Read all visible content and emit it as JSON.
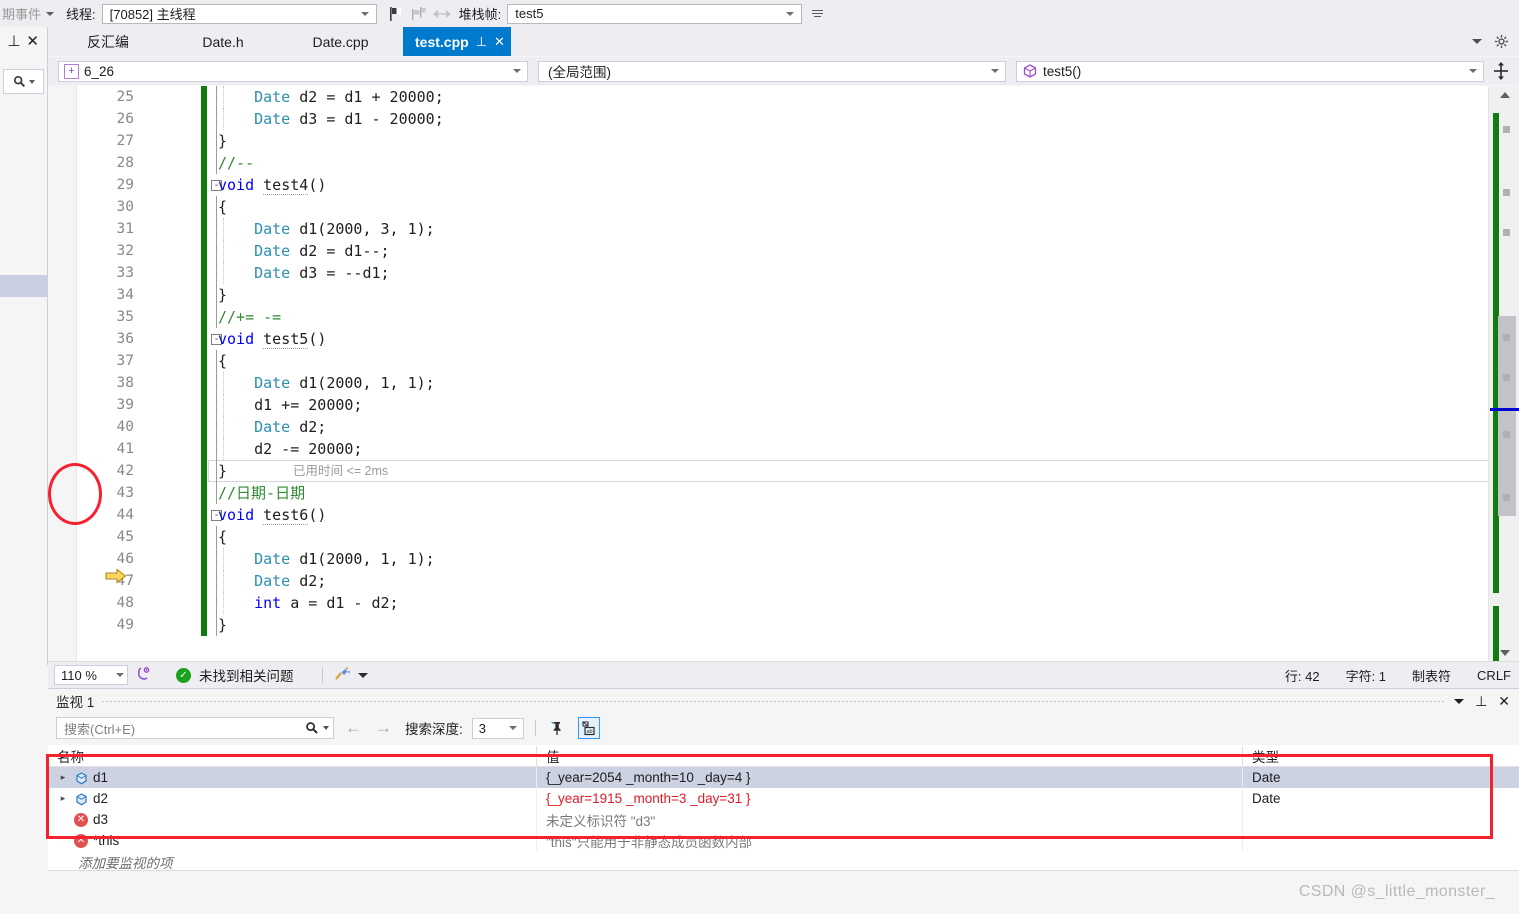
{
  "toolbar": {
    "events_label": "期事件",
    "thread_label": "线程:",
    "thread_value": "[70852] 主线程",
    "stackframe_label": "堆栈帧:",
    "stackframe_value": "test5",
    "icons": [
      "flag-icon",
      "flags-faded-icon",
      "link-faded-icon",
      "overflow-icon"
    ]
  },
  "left_strip": {
    "pin_icon": "pin-icon",
    "close_icon": "close-icon",
    "search_icon": "search-icon",
    "search_caret": "chevron-down-icon"
  },
  "tabs": {
    "items": [
      {
        "label": "反汇编",
        "active": false
      },
      {
        "label": "Date.h",
        "active": false
      },
      {
        "label": "Date.cpp",
        "active": false
      },
      {
        "label": "test.cpp",
        "active": true
      }
    ],
    "pin_icon": "pin-icon",
    "close_icon": "close-icon",
    "overflow_icon": "chevron-down-icon",
    "settings_icon": "gear-icon"
  },
  "navbar": {
    "project": "6_26",
    "project_icon": "project-icon",
    "scope": "(全局范围)",
    "member": "test5()",
    "member_icon": "cube-icon",
    "split_icon": "split-window-icon"
  },
  "editor": {
    "first_line": 25,
    "lines": [
      {
        "n": 25,
        "tokens": [
          {
            "t": "typ",
            "s": "Date"
          },
          {
            "t": "pln",
            "s": " d2 = d1 + "
          },
          {
            "t": "num",
            "s": "20000"
          },
          {
            "t": "pln",
            "s": ";"
          }
        ],
        "indent": 3,
        "change": true
      },
      {
        "n": 26,
        "tokens": [
          {
            "t": "typ",
            "s": "Date"
          },
          {
            "t": "pln",
            "s": " d3 = d1 - "
          },
          {
            "t": "num",
            "s": "20000"
          },
          {
            "t": "pln",
            "s": ";"
          }
        ],
        "indent": 3,
        "change": true
      },
      {
        "n": 27,
        "tokens": [
          {
            "t": "pln",
            "s": "}"
          }
        ],
        "indent": 1,
        "change": true
      },
      {
        "n": 28,
        "tokens": [
          {
            "t": "cmt",
            "s": "//--"
          }
        ],
        "indent": 1,
        "change": true
      },
      {
        "n": 29,
        "tokens": [
          {
            "t": "kw",
            "s": "void"
          },
          {
            "t": "pln",
            "s": " "
          },
          {
            "t": "fn",
            "s": "test4"
          },
          {
            "t": "pln",
            "s": "()"
          }
        ],
        "indent": 1,
        "change": true,
        "fold": "-"
      },
      {
        "n": 30,
        "tokens": [
          {
            "t": "pln",
            "s": "{"
          }
        ],
        "indent": 1,
        "change": true
      },
      {
        "n": 31,
        "tokens": [
          {
            "t": "typ",
            "s": "Date"
          },
          {
            "t": "pln",
            "s": " d1("
          },
          {
            "t": "num",
            "s": "2000"
          },
          {
            "t": "pln",
            "s": ", "
          },
          {
            "t": "num",
            "s": "3"
          },
          {
            "t": "pln",
            "s": ", "
          },
          {
            "t": "num",
            "s": "1"
          },
          {
            "t": "pln",
            "s": ");"
          }
        ],
        "indent": 3,
        "change": true
      },
      {
        "n": 32,
        "tokens": [
          {
            "t": "typ",
            "s": "Date"
          },
          {
            "t": "pln",
            "s": " d2 = d1--;"
          }
        ],
        "indent": 3,
        "change": true
      },
      {
        "n": 33,
        "tokens": [
          {
            "t": "typ",
            "s": "Date"
          },
          {
            "t": "pln",
            "s": " d3 = --d1;"
          }
        ],
        "indent": 3,
        "change": true
      },
      {
        "n": 34,
        "tokens": [
          {
            "t": "pln",
            "s": "}"
          }
        ],
        "indent": 1,
        "change": true
      },
      {
        "n": 35,
        "tokens": [
          {
            "t": "cmt",
            "s": "//+= -="
          }
        ],
        "indent": 1,
        "change": true
      },
      {
        "n": 36,
        "tokens": [
          {
            "t": "kw",
            "s": "void"
          },
          {
            "t": "pln",
            "s": " "
          },
          {
            "t": "fn",
            "s": "test5"
          },
          {
            "t": "pln",
            "s": "()"
          }
        ],
        "indent": 1,
        "change": true,
        "fold": "-"
      },
      {
        "n": 37,
        "tokens": [
          {
            "t": "pln",
            "s": "{"
          }
        ],
        "indent": 1,
        "change": true
      },
      {
        "n": 38,
        "tokens": [
          {
            "t": "typ",
            "s": "Date"
          },
          {
            "t": "pln",
            "s": " d1("
          },
          {
            "t": "num",
            "s": "2000"
          },
          {
            "t": "pln",
            "s": ", "
          },
          {
            "t": "num",
            "s": "1"
          },
          {
            "t": "pln",
            "s": ", "
          },
          {
            "t": "num",
            "s": "1"
          },
          {
            "t": "pln",
            "s": ");"
          }
        ],
        "indent": 3,
        "change": true
      },
      {
        "n": 39,
        "tokens": [
          {
            "t": "pln",
            "s": "d1 += "
          },
          {
            "t": "num",
            "s": "20000"
          },
          {
            "t": "pln",
            "s": ";"
          }
        ],
        "indent": 3,
        "change": true
      },
      {
        "n": 40,
        "tokens": [
          {
            "t": "typ",
            "s": "Date"
          },
          {
            "t": "pln",
            "s": " d2;"
          }
        ],
        "indent": 3,
        "change": true
      },
      {
        "n": 41,
        "tokens": [
          {
            "t": "pln",
            "s": "d2 -= "
          },
          {
            "t": "num",
            "s": "20000"
          },
          {
            "t": "pln",
            "s": ";"
          }
        ],
        "indent": 3,
        "change": true
      },
      {
        "n": 42,
        "tokens": [
          {
            "t": "pln",
            "s": "}"
          }
        ],
        "indent": 1,
        "change": true,
        "current": true,
        "elapsed": "已用时间 <= 2ms"
      },
      {
        "n": 43,
        "tokens": [
          {
            "t": "cmt",
            "s": "//日期-日期"
          }
        ],
        "indent": 1,
        "change": true
      },
      {
        "n": 44,
        "tokens": [
          {
            "t": "kw",
            "s": "void"
          },
          {
            "t": "pln",
            "s": " "
          },
          {
            "t": "fn",
            "s": "test6"
          },
          {
            "t": "pln",
            "s": "()"
          }
        ],
        "indent": 1,
        "change": true,
        "fold": "-"
      },
      {
        "n": 45,
        "tokens": [
          {
            "t": "pln",
            "s": "{"
          }
        ],
        "indent": 1,
        "change": true
      },
      {
        "n": 46,
        "tokens": [
          {
            "t": "typ",
            "s": "Date"
          },
          {
            "t": "pln",
            "s": " d1("
          },
          {
            "t": "num",
            "s": "2000"
          },
          {
            "t": "pln",
            "s": ", "
          },
          {
            "t": "num",
            "s": "1"
          },
          {
            "t": "pln",
            "s": ", "
          },
          {
            "t": "num",
            "s": "1"
          },
          {
            "t": "pln",
            "s": ");"
          }
        ],
        "indent": 3,
        "change": true
      },
      {
        "n": 47,
        "tokens": [
          {
            "t": "typ",
            "s": "Date"
          },
          {
            "t": "pln",
            "s": " d2;"
          }
        ],
        "indent": 3,
        "change": true
      },
      {
        "n": 48,
        "tokens": [
          {
            "t": "kw",
            "s": "int"
          },
          {
            "t": "pln",
            "s": " a = d1 - d2;"
          }
        ],
        "indent": 3,
        "change": true
      },
      {
        "n": 49,
        "tokens": [
          {
            "t": "pln",
            "s": "}"
          }
        ],
        "indent": 1,
        "change": true
      }
    ],
    "exec_arrow_icon": "current-statement-arrow-icon",
    "annotation_icon": "red-circle-annotation"
  },
  "status": {
    "zoom": "110 %",
    "zoom_caret": "chevron-down-icon",
    "intellicode_icon": "intellicode-icon",
    "problems": "未找到相关问题",
    "problems_icon": "check-circle-icon",
    "broom_icon": "code-cleanup-icon",
    "broom_caret": "chevron-down-icon",
    "line": "行: 42",
    "column": "字符: 1",
    "tabs_mode": "制表符",
    "eol": "CRLF"
  },
  "watch": {
    "title": "监视 1",
    "window_icons": [
      "chevron-down-icon",
      "pin-icon",
      "close-icon"
    ],
    "search_placeholder": "搜索(Ctrl+E)",
    "search_icon": "search-icon",
    "search_caret": "chevron-down-icon",
    "back_icon": "arrow-left-icon",
    "forward_icon": "arrow-right-icon",
    "depth_label": "搜索深度:",
    "depth_value": "3",
    "depth_caret": "chevron-down-icon",
    "pin_tool_icon": "pin-column-icon",
    "hex_tool_icon": "hex-display-icon",
    "columns": [
      "名称",
      "值",
      "类型"
    ],
    "rows": [
      {
        "expander": "▸",
        "icon": "object-icon",
        "name": "d1",
        "value": "{_year=2054 _month=10 _day=4 }",
        "value_color": "black",
        "type": "Date",
        "selected": true,
        "refresh": false
      },
      {
        "expander": "▸",
        "icon": "object-icon",
        "name": "d2",
        "value": "{_year=1915 _month=3 _day=31 }",
        "value_color": "red",
        "type": "Date",
        "selected": false,
        "refresh": false
      },
      {
        "expander": "",
        "icon": "error-icon",
        "name": "d3",
        "value": "未定义标识符 \"d3\"",
        "value_color": "gray",
        "type": "",
        "selected": false,
        "refresh": true
      },
      {
        "expander": "",
        "icon": "error-icon",
        "name": "*this",
        "value": "\"this\"只能用于非静态成员函数内部",
        "value_color": "gray",
        "type": "",
        "selected": false,
        "refresh": true
      }
    ],
    "add_item_placeholder": "添加要监视的项"
  },
  "watermark": "CSDN @s_little_monster_",
  "colors": {
    "accent": "#007acc",
    "changebar_green": "#107c10",
    "error_red": "#e01b24",
    "annotation_red": "#f5222d",
    "selection": "#cdd2e2"
  }
}
